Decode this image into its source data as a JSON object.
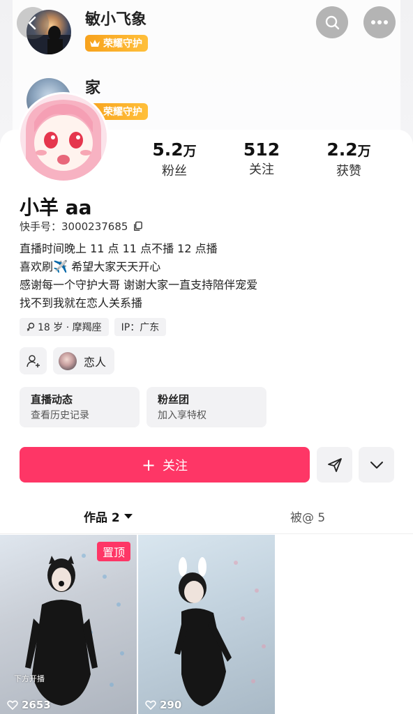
{
  "guard_list": [
    {
      "name": "敏小飞象",
      "badge": "荣耀守护"
    },
    {
      "name": "家",
      "badge": "荣耀守护"
    }
  ],
  "header": {
    "back_icon": "chevron-left-icon",
    "search_icon": "search-icon",
    "more_icon": "more-dots-icon"
  },
  "stats": {
    "fans": {
      "value": "5.2",
      "unit": "万",
      "label": "粉丝"
    },
    "following": {
      "value": "512",
      "label": "关注"
    },
    "likes": {
      "value": "2.2",
      "unit": "万",
      "label": "获赞"
    }
  },
  "profile": {
    "nickname": "小羊 aa",
    "ks_id": "快手号：3000237685",
    "bio": [
      "直播时间晚上 11 点 11 点不播 12 点播",
      "喜欢刷",
      " 希望大家天天开心",
      "感谢每一个守护大哥 谢谢大家一直支持陪伴宠爱",
      "找不到我就在恋人关系播"
    ],
    "bio_emoji": "✈️",
    "tags": [
      "18 岁 · 摩羯座",
      "IP：广东"
    ]
  },
  "relation": {
    "label": "恋人"
  },
  "cards": [
    {
      "title": "直播动态",
      "subtitle": "查看历史记录"
    },
    {
      "title": "粉丝团",
      "subtitle": "加入享特权"
    }
  ],
  "actions": {
    "follow_plus": "+",
    "follow_label": "关注"
  },
  "tabs": {
    "works": "作品 2",
    "at": "被@ 5"
  },
  "videos": [
    {
      "pinned": "置顶",
      "caption": "下方开播",
      "likes": "2653"
    },
    {
      "likes": "290"
    }
  ],
  "colors": {
    "accent": "#fe3666",
    "badge_gold": "#f7a21d"
  }
}
